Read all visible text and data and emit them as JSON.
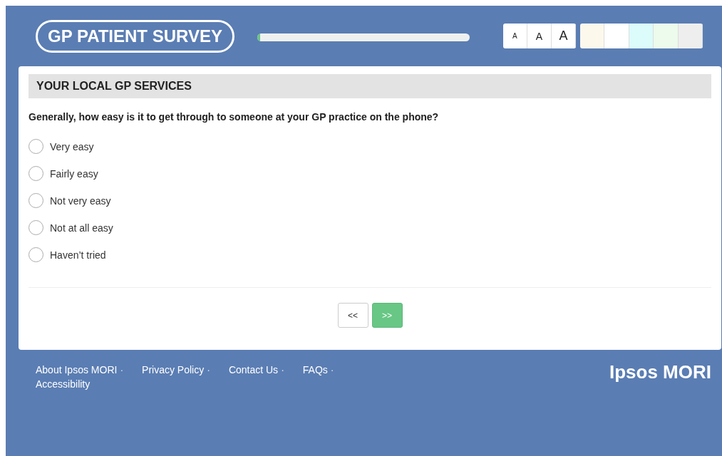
{
  "header": {
    "logo": "GP PATIENT SURVEY",
    "progress": {
      "level": 0.01
    },
    "font_sizes": [
      {
        "label": "A",
        "kind": "small"
      },
      {
        "label": "A",
        "kind": "medium"
      },
      {
        "label": "A",
        "kind": "large"
      }
    ],
    "themes": [
      {
        "color": "#fdf8ec"
      },
      {
        "color": "#ffffff"
      },
      {
        "color": "#dcfbfb"
      },
      {
        "color": "#ecfbec"
      },
      {
        "color": "#eeeeee"
      }
    ]
  },
  "section": {
    "title": "YOUR LOCAL GP SERVICES"
  },
  "question": "Generally, how easy is it to get through to someone at your GP practice on the phone?",
  "options": [
    {
      "label": "Very easy",
      "selected": false
    },
    {
      "label": "Fairly easy",
      "selected": false
    },
    {
      "label": "Not very easy",
      "selected": false
    },
    {
      "label": "Not at all easy",
      "selected": false
    },
    {
      "label": "Haven’t tried",
      "selected": false
    }
  ],
  "nav": {
    "back": "<<",
    "next": ">>"
  },
  "footer": {
    "links": [
      {
        "label": "About Ipsos MORI",
        "separator": "·"
      },
      {
        "label": "Privacy Policy",
        "separator": "·"
      },
      {
        "label": "Contact Us",
        "separator": "·"
      },
      {
        "label": "FAQs",
        "separator": "·"
      },
      {
        "label": "Accessibility"
      }
    ],
    "brand": "Ipsos MORI"
  }
}
